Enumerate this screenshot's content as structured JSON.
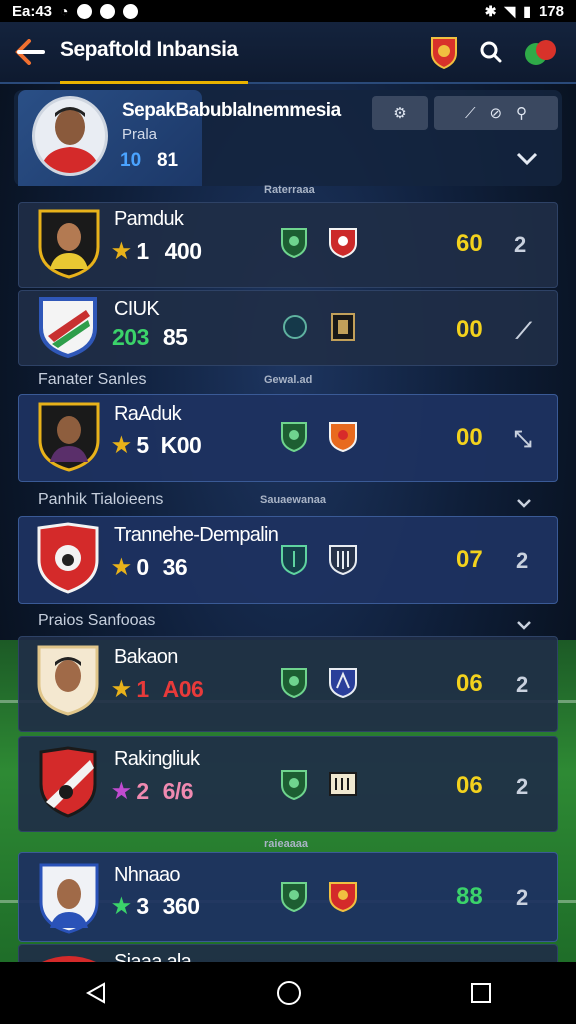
{
  "status_bar": {
    "time": "Ea:43",
    "battery": "178"
  },
  "app_bar": {
    "title": "Sepaftold Inbansia"
  },
  "profile": {
    "name": "SepakBabublaInemmesia",
    "subtitle": "Prala",
    "stat_a": "10",
    "stat_b": "81"
  },
  "labels": {
    "micro_1": "Raterraaa",
    "section_1": "Fanater Sanles",
    "micro_2": "Gewal.ad",
    "section_2": "Panhik Tialoieens",
    "micro_3": "Sauaewanaa",
    "section_3": "Praios Sanfooas",
    "micro_4": "raieaaaa"
  },
  "players": [
    {
      "name": "Pamduk",
      "star_value": "1",
      "stat": "400",
      "score": "60",
      "edit": "2",
      "score_color": "#f3d21d",
      "stat_color": "#ffffff",
      "star_color": "#e8b21a"
    },
    {
      "name": "CIUK",
      "star_value": "203",
      "stat": "85",
      "score": "00",
      "edit": "⟋",
      "score_color": "#f3d21d",
      "stat_color": "#ffffff",
      "star_color": "#3bd36a"
    },
    {
      "name": "RaAduk",
      "star_value": "5",
      "stat": "K00",
      "score": "00",
      "edit": "⤡",
      "score_color": "#f3d21d",
      "stat_color": "#ffffff",
      "star_color": "#e8b21a"
    },
    {
      "name": "Trannehe-Dempalin",
      "star_value": "0",
      "stat": "36",
      "score": "07",
      "edit": "2",
      "score_color": "#f3d21d",
      "stat_color": "#ffffff",
      "star_color": "#e8b21a"
    },
    {
      "name": "Bakaon",
      "star_value": "1",
      "stat": "A06",
      "score": "06",
      "edit": "2",
      "score_color": "#f3d21d",
      "stat_color": "#e83a3a",
      "star_color": "#e8b21a"
    },
    {
      "name": "Rakingliuk",
      "star_value": "2",
      "stat": "6/6",
      "score": "06",
      "edit": "2",
      "score_color": "#f3d21d",
      "stat_color": "#f08ab0",
      "star_color": "#c04bd0"
    },
    {
      "name": "Nhnaao",
      "star_value": "3",
      "stat": "360",
      "score": "88",
      "edit": "2",
      "score_color": "#3bd36a",
      "stat_color": "#ffffff",
      "star_color": "#3bd36a"
    },
    {
      "name": "Siaaa ala"
    }
  ]
}
